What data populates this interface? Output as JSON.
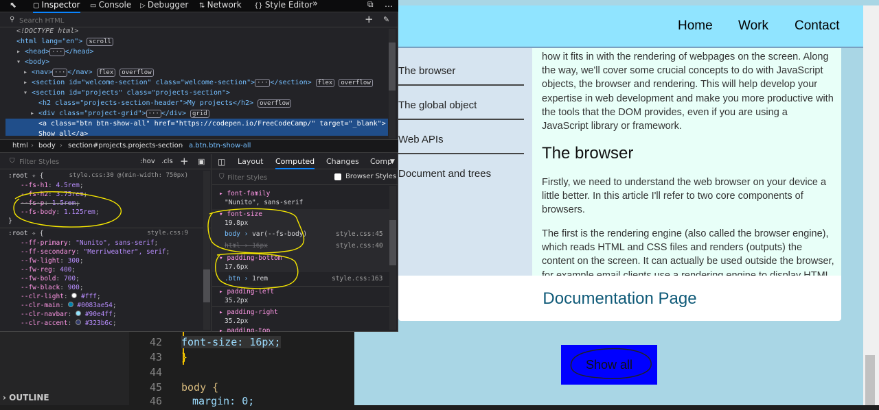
{
  "editor": {
    "lines": [
      {
        "num": "42",
        "code": "font-size: 16px;"
      },
      {
        "num": "43",
        "code": "}"
      },
      {
        "num": "44",
        "code": ""
      },
      {
        "num": "45",
        "code": "body {"
      },
      {
        "num": "46",
        "code": "margin: 0;"
      }
    ],
    "outline_label": "OUTLINE"
  },
  "page": {
    "nav": [
      "Home",
      "Work",
      "Contact"
    ],
    "toc": [
      "The browser",
      "The global object",
      "Web APIs",
      "Document and trees"
    ],
    "article": {
      "intro": "how it fits in with the rendering of webpages on the screen. Along the way, we'll cover some crucial concepts to do with JavaScript objects, the browser and rendering. This will help develop your expertise in web development and make you more productive with the tools that the DOM provides, even if you are using a JavaScript library or framework.",
      "heading": "The browser",
      "p1": "Firstly, we need to understand the web browser on your device a little better. In this article I'll refer to two core components of browsers.",
      "p2": "The first is the rendering engine (also called the browser engine), which reads HTML and CSS files and renders (outputs) the content on the screen. It can actually be used outside the browser, for example email clients use a rendering engine to display HTML"
    },
    "doc_title": "Documentation Page",
    "show_all": "Show all"
  },
  "devtools": {
    "tabs": [
      "Inspector",
      "Console",
      "Debugger",
      "Network",
      "Style Editor"
    ],
    "search_placeholder": "Search HTML",
    "tree": {
      "doctype": "<!DOCTYPE html>",
      "html_open": "<html lang=\"en\">",
      "head": "<head>",
      "body": "<body>",
      "nav": "<nav>",
      "welcome": "<section id=\"welcome-section\" class=\"welcome-section\">",
      "projects": "<section id=\"projects\" class=\"projects-section\">",
      "h2": "<h2 class=\"projects-section-header\">My projects</h2>",
      "grid": "<div class=\"project-grid\">",
      "a_line1": "<a class=\"btn btn-show-all\" href=\"https://codepen.io/FreeCodeCamp/\" target=\"_blank\">",
      "a_line2": "Show all</a>",
      "badges": {
        "scroll": "scroll",
        "flex": "flex",
        "overflow": "overflow",
        "grid": "grid"
      }
    },
    "breadcrumbs": [
      "html",
      "body",
      "section#projects.projects-section",
      "a.btn.btn-show-all"
    ],
    "rules": {
      "filter": "Filter Styles",
      "toggles": [
        ":hov",
        ".cls"
      ],
      "rule1": {
        "selector": ":root",
        "source": "style.css:30 @(min-width: 750px)",
        "decls": [
          [
            "--fs-h1",
            "4.5rem"
          ],
          [
            "--fs-h2",
            "3.75rem"
          ],
          [
            "--fs-p",
            "1.5rem"
          ],
          [
            "--fs-body",
            "1.125rem"
          ]
        ]
      },
      "rule2": {
        "selector": ":root",
        "source": "style.css:9",
        "decls": [
          [
            "--ff-primary",
            "\"Nunito\", sans-serif"
          ],
          [
            "--ff-secondary",
            "\"Merriweather\", serif"
          ],
          [
            "--fw-light",
            "300"
          ],
          [
            "--fw-reg",
            "400"
          ],
          [
            "--fw-bold",
            "700"
          ],
          [
            "--fw-black",
            "900"
          ],
          [
            "--clr-light",
            "#fff"
          ],
          [
            "--clr-main",
            "#0083ae54"
          ],
          [
            "--clr-navbar",
            "#90e4ff"
          ],
          [
            "--clr-accent",
            "#323b6c"
          ]
        ]
      }
    },
    "side_tabs": [
      "Layout",
      "Computed",
      "Changes",
      "Comp"
    ],
    "computed": {
      "filter": "Filter Styles",
      "browser_styles": "Browser Styles",
      "props": [
        {
          "name": "font-family",
          "value": "\"Nunito\", sans-serif"
        },
        {
          "name": "font-size",
          "value": "19.8px",
          "sub": [
            {
              "sel": "body",
              "val": "var(--fs-body)",
              "src": "style.css:45"
            },
            {
              "sel": "html",
              "val": "16px",
              "src": "style.css:40",
              "struck": true
            }
          ]
        },
        {
          "name": "padding-bottom",
          "value": "17.6px",
          "sub": [
            {
              "sel": ".btn",
              "val": "1rem",
              "src": "style.css:163"
            }
          ]
        },
        {
          "name": "padding-left",
          "value": "35.2px"
        },
        {
          "name": "padding-right",
          "value": "35.2px"
        },
        {
          "name": "padding-top",
          "value": ""
        }
      ]
    }
  },
  "colors": {
    "clr-light": "#ffffff",
    "clr-main": "#0083ae",
    "clr-navbar": "#90e4ff",
    "clr-accent": "#323b6c",
    "annotation": "#f5e600"
  }
}
